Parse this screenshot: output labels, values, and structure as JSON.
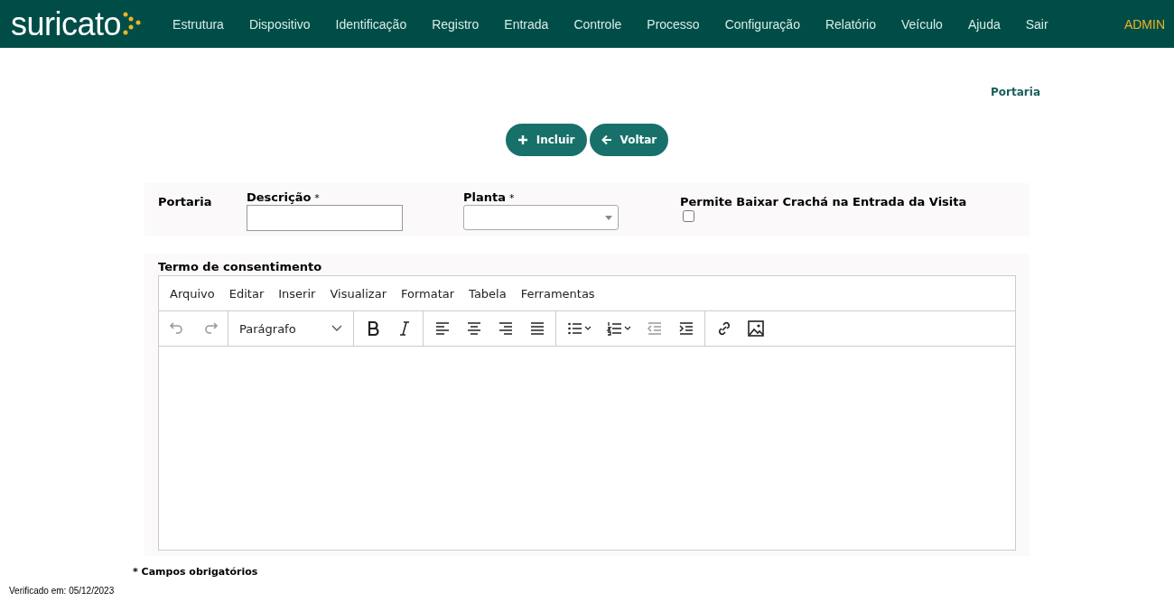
{
  "header": {
    "logo": "suricato",
    "nav": [
      {
        "label": "Estrutura"
      },
      {
        "label": "Dispositivo"
      },
      {
        "label": "Identificação"
      },
      {
        "label": "Registro"
      },
      {
        "label": "Entrada"
      },
      {
        "label": "Controle"
      },
      {
        "label": "Processo"
      },
      {
        "label": "Configuração"
      },
      {
        "label": "Relatório"
      },
      {
        "label": "Veículo"
      },
      {
        "label": "Ajuda"
      },
      {
        "label": "Sair"
      }
    ],
    "user": "ADMIN"
  },
  "page_title": "Portaria",
  "actions": [
    {
      "label": "Incluir",
      "kind": "add"
    },
    {
      "label": "Voltar",
      "kind": "back"
    }
  ],
  "form": {
    "section": "Portaria",
    "fields": [
      {
        "label": "Descrição",
        "required_mark": "*",
        "kind": "text"
      },
      {
        "label": "Planta",
        "required_mark": "*",
        "kind": "select"
      },
      {
        "label": "Permite Baixar Crachá na Entrada da Visita",
        "kind": "checkbox",
        "checked": false
      }
    ]
  },
  "editor": {
    "label": "Termo de consentimento",
    "menu": [
      "Arquivo",
      "Editar",
      "Inserir",
      "Visualizar",
      "Formatar",
      "Tabela",
      "Ferramentas"
    ],
    "toolbar": [
      [
        {
          "kind": "undo",
          "disabled": true
        },
        {
          "kind": "redo",
          "disabled": true
        }
      ],
      [
        {
          "kind": "block",
          "label": "Parágrafo",
          "disabled": false
        }
      ],
      [
        {
          "kind": "bold",
          "disabled": false
        },
        {
          "kind": "italic",
          "disabled": false
        }
      ],
      [
        {
          "kind": "align-left",
          "disabled": false
        },
        {
          "kind": "align-center",
          "disabled": false
        },
        {
          "kind": "align-right",
          "disabled": false
        },
        {
          "kind": "justify",
          "disabled": false
        }
      ],
      [
        {
          "kind": "bullets",
          "disabled": false
        },
        {
          "kind": "numbers",
          "disabled": false
        },
        {
          "kind": "outdent",
          "disabled": true
        },
        {
          "kind": "indent",
          "disabled": false
        }
      ],
      [
        {
          "kind": "link",
          "disabled": false
        },
        {
          "kind": "image",
          "disabled": false
        }
      ]
    ]
  },
  "required_note": "* Campos obrigatórios",
  "verified": "Verificado em: 05/12/2023"
}
